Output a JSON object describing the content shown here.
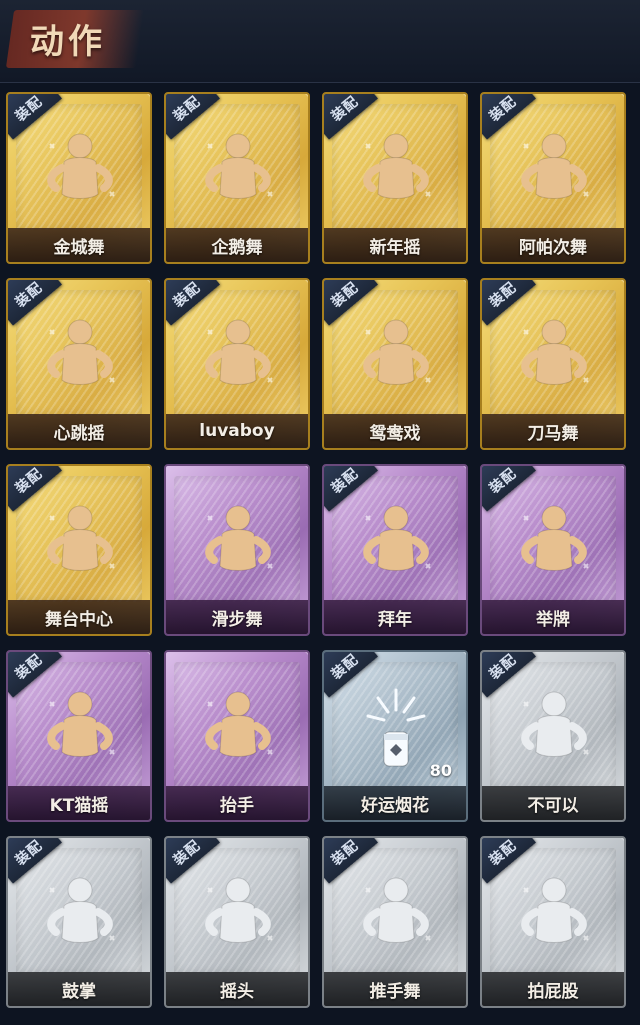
{
  "header": {
    "title": "动作"
  },
  "items": [
    {
      "name": "金城舞",
      "rarity": "gold",
      "equip_badge": "装配",
      "icon": "dancer-figure-icon"
    },
    {
      "name": "企鹅舞",
      "rarity": "gold",
      "equip_badge": "装配",
      "icon": "dancer-figure-icon"
    },
    {
      "name": "新年摇",
      "rarity": "gold",
      "equip_badge": "装配",
      "icon": "dancer-figure-icon"
    },
    {
      "name": "阿帕次舞",
      "rarity": "gold",
      "equip_badge": "装配",
      "icon": "dancer-figure-icon"
    },
    {
      "name": "心跳摇",
      "rarity": "gold",
      "equip_badge": "装配",
      "icon": "dancer-figure-icon"
    },
    {
      "name": "luvaboy",
      "rarity": "gold",
      "equip_badge": "装配",
      "icon": "dancer-figure-icon"
    },
    {
      "name": "鸳鸯戏",
      "rarity": "gold",
      "equip_badge": "装配",
      "icon": "dancer-figure-icon"
    },
    {
      "name": "刀马舞",
      "rarity": "gold",
      "equip_badge": "装配",
      "icon": "dancer-figure-icon"
    },
    {
      "name": "舞台中心",
      "rarity": "gold",
      "equip_badge": "装配",
      "icon": "dancer-figure-icon"
    },
    {
      "name": "滑步舞",
      "rarity": "purple",
      "equip_badge": "",
      "icon": "dancer-figure-icon"
    },
    {
      "name": "拜年",
      "rarity": "purple",
      "equip_badge": "装配",
      "icon": "bow-figure-icon"
    },
    {
      "name": "举牌",
      "rarity": "purple",
      "equip_badge": "装配",
      "icon": "sign-figure-icon"
    },
    {
      "name": "KT猫摇",
      "rarity": "purple",
      "equip_badge": "装配",
      "icon": "dancer-figure-icon"
    },
    {
      "name": "抬手",
      "rarity": "purple",
      "equip_badge": "",
      "icon": "raise-hand-figure-icon"
    },
    {
      "name": "好运烟花",
      "rarity": "blue",
      "equip_badge": "装配",
      "icon": "firework-icon",
      "count": "80"
    },
    {
      "name": "不可以",
      "rarity": "grey",
      "equip_badge": "装配",
      "icon": "finger-wag-icon"
    },
    {
      "name": "鼓掌",
      "rarity": "grey",
      "equip_badge": "装配",
      "icon": "clap-hands-icon"
    },
    {
      "name": "摇头",
      "rarity": "grey",
      "equip_badge": "装配",
      "icon": "shake-head-figure-icon"
    },
    {
      "name": "推手舞",
      "rarity": "grey",
      "equip_badge": "装配",
      "icon": "dancer-figure-icon"
    },
    {
      "name": "拍屁股",
      "rarity": "grey",
      "equip_badge": "装配",
      "icon": "dancer-figure-icon"
    }
  ],
  "colors": {
    "gold": "#e7c355",
    "purple": "#b78acb",
    "blue": "#aebfcc",
    "grey": "#c9ced3"
  }
}
